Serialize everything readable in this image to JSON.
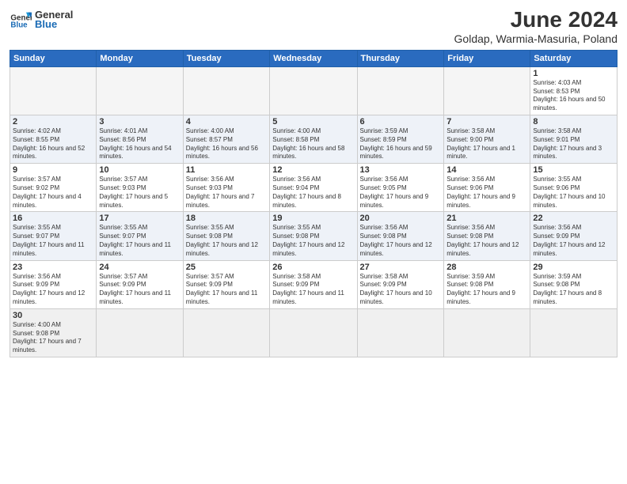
{
  "header": {
    "logo_line1": "General",
    "logo_line2": "Blue",
    "title": "June 2024",
    "subtitle": "Goldap, Warmia-Masuria, Poland"
  },
  "days_of_week": [
    "Sunday",
    "Monday",
    "Tuesday",
    "Wednesday",
    "Thursday",
    "Friday",
    "Saturday"
  ],
  "weeks": [
    [
      {
        "day": null
      },
      {
        "day": null
      },
      {
        "day": null
      },
      {
        "day": null
      },
      {
        "day": null
      },
      {
        "day": null
      },
      {
        "day": "1",
        "sunrise": "4:03 AM",
        "sunset": "8:53 PM",
        "daylight": "16 hours and 50 minutes."
      }
    ],
    [
      {
        "day": "2",
        "sunrise": "4:02 AM",
        "sunset": "8:55 PM",
        "daylight": "16 hours and 52 minutes."
      },
      {
        "day": "3",
        "sunrise": "4:01 AM",
        "sunset": "8:56 PM",
        "daylight": "16 hours and 54 minutes."
      },
      {
        "day": "4",
        "sunrise": "4:00 AM",
        "sunset": "8:57 PM",
        "daylight": "16 hours and 56 minutes."
      },
      {
        "day": "5",
        "sunrise": "4:00 AM",
        "sunset": "8:58 PM",
        "daylight": "16 hours and 58 minutes."
      },
      {
        "day": "6",
        "sunrise": "3:59 AM",
        "sunset": "8:59 PM",
        "daylight": "16 hours and 59 minutes."
      },
      {
        "day": "7",
        "sunrise": "3:58 AM",
        "sunset": "9:00 PM",
        "daylight": "17 hours and 1 minute."
      },
      {
        "day": "8",
        "sunrise": "3:58 AM",
        "sunset": "9:01 PM",
        "daylight": "17 hours and 3 minutes."
      }
    ],
    [
      {
        "day": "9",
        "sunrise": "3:57 AM",
        "sunset": "9:02 PM",
        "daylight": "17 hours and 4 minutes."
      },
      {
        "day": "10",
        "sunrise": "3:57 AM",
        "sunset": "9:03 PM",
        "daylight": "17 hours and 5 minutes."
      },
      {
        "day": "11",
        "sunrise": "3:56 AM",
        "sunset": "9:03 PM",
        "daylight": "17 hours and 7 minutes."
      },
      {
        "day": "12",
        "sunrise": "3:56 AM",
        "sunset": "9:04 PM",
        "daylight": "17 hours and 8 minutes."
      },
      {
        "day": "13",
        "sunrise": "3:56 AM",
        "sunset": "9:05 PM",
        "daylight": "17 hours and 9 minutes."
      },
      {
        "day": "14",
        "sunrise": "3:56 AM",
        "sunset": "9:06 PM",
        "daylight": "17 hours and 9 minutes."
      },
      {
        "day": "15",
        "sunrise": "3:55 AM",
        "sunset": "9:06 PM",
        "daylight": "17 hours and 10 minutes."
      }
    ],
    [
      {
        "day": "16",
        "sunrise": "3:55 AM",
        "sunset": "9:07 PM",
        "daylight": "17 hours and 11 minutes."
      },
      {
        "day": "17",
        "sunrise": "3:55 AM",
        "sunset": "9:07 PM",
        "daylight": "17 hours and 11 minutes."
      },
      {
        "day": "18",
        "sunrise": "3:55 AM",
        "sunset": "9:08 PM",
        "daylight": "17 hours and 12 minutes."
      },
      {
        "day": "19",
        "sunrise": "3:55 AM",
        "sunset": "9:08 PM",
        "daylight": "17 hours and 12 minutes."
      },
      {
        "day": "20",
        "sunrise": "3:56 AM",
        "sunset": "9:08 PM",
        "daylight": "17 hours and 12 minutes."
      },
      {
        "day": "21",
        "sunrise": "3:56 AM",
        "sunset": "9:08 PM",
        "daylight": "17 hours and 12 minutes."
      },
      {
        "day": "22",
        "sunrise": "3:56 AM",
        "sunset": "9:09 PM",
        "daylight": "17 hours and 12 minutes."
      }
    ],
    [
      {
        "day": "23",
        "sunrise": "3:56 AM",
        "sunset": "9:09 PM",
        "daylight": "17 hours and 12 minutes."
      },
      {
        "day": "24",
        "sunrise": "3:57 AM",
        "sunset": "9:09 PM",
        "daylight": "17 hours and 11 minutes."
      },
      {
        "day": "25",
        "sunrise": "3:57 AM",
        "sunset": "9:09 PM",
        "daylight": "17 hours and 11 minutes."
      },
      {
        "day": "26",
        "sunrise": "3:58 AM",
        "sunset": "9:09 PM",
        "daylight": "17 hours and 11 minutes."
      },
      {
        "day": "27",
        "sunrise": "3:58 AM",
        "sunset": "9:09 PM",
        "daylight": "17 hours and 10 minutes."
      },
      {
        "day": "28",
        "sunrise": "3:59 AM",
        "sunset": "9:08 PM",
        "daylight": "17 hours and 9 minutes."
      },
      {
        "day": "29",
        "sunrise": "3:59 AM",
        "sunset": "9:08 PM",
        "daylight": "17 hours and 8 minutes."
      }
    ],
    [
      {
        "day": "30",
        "sunrise": "4:00 AM",
        "sunset": "9:08 PM",
        "daylight": "17 hours and 7 minutes."
      },
      {
        "day": null
      },
      {
        "day": null
      },
      {
        "day": null
      },
      {
        "day": null
      },
      {
        "day": null
      },
      {
        "day": null
      }
    ]
  ]
}
